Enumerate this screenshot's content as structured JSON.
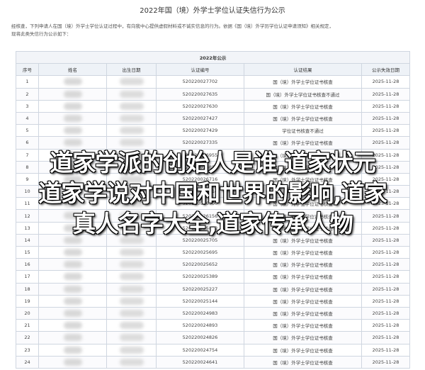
{
  "document": {
    "title": "2022年国（境）外学士学位认证失信行为公示",
    "intro_line1": "经核查，下列申请人在国（境）外学士学位认证过程中，有向我中心提供虚假材料或不诚实信息的行为。依据《国（境）外学历学位认证申请须知》相关规定，",
    "intro_line2": "现将此类失信行为公示如下："
  },
  "table": {
    "caption": "2022年公示",
    "headers": [
      "序号",
      "姓名",
      "出生日期",
      "认证编号",
      "认证结果",
      "公示失效日期"
    ],
    "rows": [
      {
        "no": "1",
        "id": "520220027702",
        "result": "国（境）外学士学位证书核查",
        "expire": "2025-11-28"
      },
      {
        "no": "2",
        "id": "520220027635",
        "result": "国（境）外学士学位证书核查不通过",
        "expire": "2025-11-28"
      },
      {
        "no": "3",
        "id": "520220027630",
        "result": "国（境）外学士学位证书核查",
        "expire": "2025-11-28"
      },
      {
        "no": "4",
        "id": "520220027427",
        "result": "国（境）外学士学位证书核查",
        "expire": "2025-11-28"
      },
      {
        "no": "5",
        "id": "520220027429",
        "result": "学位证书核查不通过",
        "expire": "2025-11-28"
      },
      {
        "no": "6",
        "id": "520220027335",
        "result": "国（境）外学士学位证书核查",
        "expire": "2025-11-28"
      },
      {
        "no": "7",
        "id": "520220026955",
        "result": "国（境）外学士学位证书核查",
        "expire": "2025-11-28"
      },
      {
        "no": "8",
        "id": "520220026883",
        "result": "国（境）外学士学位证书核查",
        "expire": "2025-11-28"
      },
      {
        "no": "9",
        "id": "520220026716",
        "result": "国（境）外学士学位证书核查",
        "expire": "2025-11-28"
      },
      {
        "no": "10",
        "id": "520220026514",
        "result": "国（境）外学士学位证书核查",
        "expire": "2025-11-28"
      },
      {
        "no": "11",
        "id": "520220026300",
        "result": "国（境）外学士学位证书核查",
        "expire": "2025-11-28"
      },
      {
        "no": "12",
        "id": "520220026156",
        "result": "国（境）外学士学位证书核查",
        "expire": "2025-11-28"
      },
      {
        "no": "13",
        "id": "520220025802",
        "result": "国（境）外学士学位证书核查",
        "expire": "2025-11-28"
      },
      {
        "no": "14",
        "id": "520220025705",
        "result": "国（境）外学士学位证书核查",
        "expire": "2025-11-28"
      },
      {
        "no": "15",
        "id": "520220025695",
        "result": "国（境）外学士学位证书核查",
        "expire": "2025-11-28"
      },
      {
        "no": "16",
        "id": "520220025652",
        "result": "国（境）外学士学位证书核查",
        "expire": "2025-11-28"
      },
      {
        "no": "17",
        "id": "520220025389",
        "result": "国（境）外学士学位证书核查",
        "expire": "2025-11-28"
      },
      {
        "no": "18",
        "id": "520220025227",
        "result": "国（境）外学士学位证书核查",
        "expire": "2025-11-28"
      },
      {
        "no": "19",
        "id": "520220025144",
        "result": "国（境）外学士学位证书核查",
        "expire": "2025-11-28"
      },
      {
        "no": "20",
        "id": "520220024983",
        "result": "国（境）外学士学位证书核查",
        "expire": "2025-11-28"
      },
      {
        "no": "21",
        "id": "520220024893",
        "result": "国（境）外学士学位证书核查",
        "expire": "2025-11-28"
      },
      {
        "no": "22",
        "id": "520220024826",
        "result": "国（境）外学士学位证书核查",
        "expire": "2025-11-28"
      },
      {
        "no": "23",
        "id": "520220024754",
        "result": "国（境）外学士学位证书核查",
        "expire": "2025-11-28"
      },
      {
        "no": "24",
        "id": "520220024641",
        "result": "国（境）外学士学位证书核查",
        "expire": "2025-11-28"
      }
    ]
  },
  "overlay": {
    "line1": "道家学派的创始人是谁,道家状元",
    "line2": "道家学说对中国和世界的影响,道家",
    "line3": "真人名字大全,道家传承人物"
  }
}
